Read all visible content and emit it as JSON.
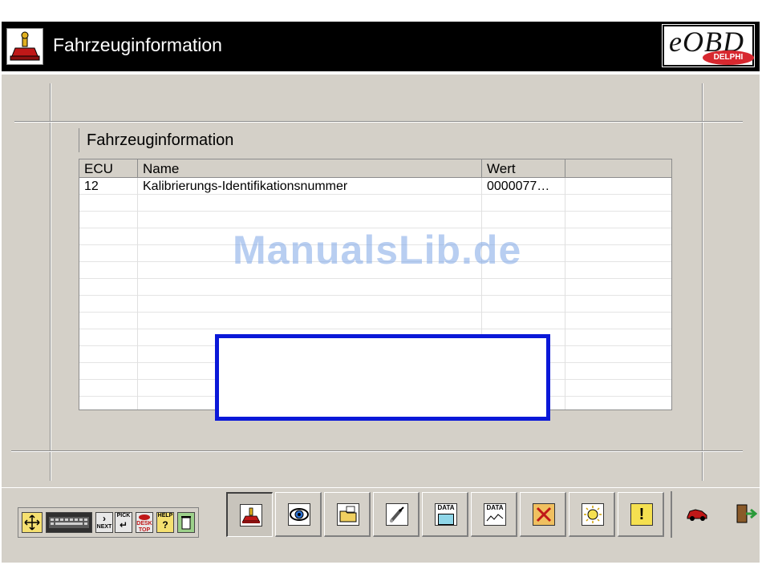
{
  "window": {
    "title": "Fahrzeuginformation"
  },
  "logo": {
    "text": "eOBD",
    "badge": "DELPHI"
  },
  "group": {
    "title": "Fahrzeuginformation"
  },
  "table": {
    "columns": [
      "ECU",
      "Name",
      "Wert",
      ""
    ],
    "rows": [
      [
        "12",
        "Kalibrierungs-Identifikationsnummer",
        "0000077…",
        ""
      ]
    ]
  },
  "watermark": "ManualsLib.de",
  "toolbar": {
    "mini_buttons": [
      {
        "icon": "move-arrows-icon",
        "label": ""
      },
      {
        "icon": "keyboard-icon",
        "label": ""
      },
      {
        "icon": "next-icon",
        "label": "NEXT"
      },
      {
        "icon": "pick-icon",
        "label": "PICK"
      },
      {
        "icon": "desktop-icon",
        "label": "DESK TOP"
      },
      {
        "icon": "help-icon",
        "label": "HELP"
      },
      {
        "icon": "trash-icon",
        "label": ""
      }
    ],
    "main_buttons": [
      {
        "icon": "vehicle-info-icon",
        "label": ""
      },
      {
        "icon": "eye-icon",
        "label": ""
      },
      {
        "icon": "folder-icon",
        "label": ""
      },
      {
        "icon": "spark-plug-icon",
        "label": ""
      },
      {
        "icon": "data-live-icon",
        "label": "DATA"
      },
      {
        "icon": "data-graph-icon",
        "label": "DATA"
      },
      {
        "icon": "clear-codes-icon",
        "label": ""
      },
      {
        "icon": "lamp-icon",
        "label": ""
      },
      {
        "icon": "warning-icon",
        "label": "!"
      },
      {
        "icon": "car-icon",
        "label": ""
      },
      {
        "icon": "exit-icon",
        "label": ""
      }
    ]
  },
  "colors": {
    "titlebar": "#000000",
    "window": "#d4d0c8",
    "highlight_box": "#0a18d8",
    "logo_badge": "#d7282f"
  }
}
